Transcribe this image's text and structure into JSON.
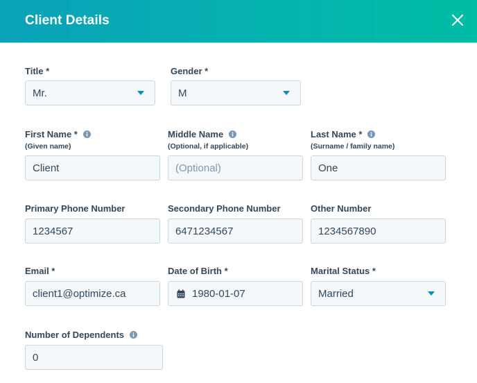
{
  "dialog": {
    "title": "Client Details",
    "close_icon": "close-icon"
  },
  "fields": {
    "title": {
      "label": "Title *",
      "value": "Mr."
    },
    "gender": {
      "label": "Gender *",
      "value": "M"
    },
    "first_name": {
      "label": "First Name *",
      "sublabel": "(Given name)",
      "value": "Client"
    },
    "middle_name": {
      "label": "Middle Name",
      "sublabel": "(Optional, if applicable)",
      "placeholder": "(Optional)",
      "value": ""
    },
    "last_name": {
      "label": "Last Name *",
      "sublabel": "(Surname / family name)",
      "value": "One"
    },
    "primary_phone": {
      "label": "Primary Phone Number",
      "value": "1234567"
    },
    "secondary_phone": {
      "label": "Secondary Phone Number",
      "value": "6471234567"
    },
    "other_number": {
      "label": "Other Number",
      "value": "1234567890"
    },
    "email": {
      "label": "Email *",
      "value": "client1@optimize.ca"
    },
    "dob": {
      "label": "Date of Birth *",
      "value": "1980-01-07"
    },
    "marital_status": {
      "label": "Marital Status *",
      "value": "Married"
    },
    "dependents": {
      "label": "Number of Dependents",
      "value": "0"
    }
  },
  "colors": {
    "header_gradient_start": "#0aa1b9",
    "header_gradient_end": "#00bda5",
    "accent": "#0091ae",
    "text": "#33475b",
    "input_bg": "#f5f8fa",
    "input_border": "#cbd6e2",
    "info_icon": "#7c98b6"
  }
}
